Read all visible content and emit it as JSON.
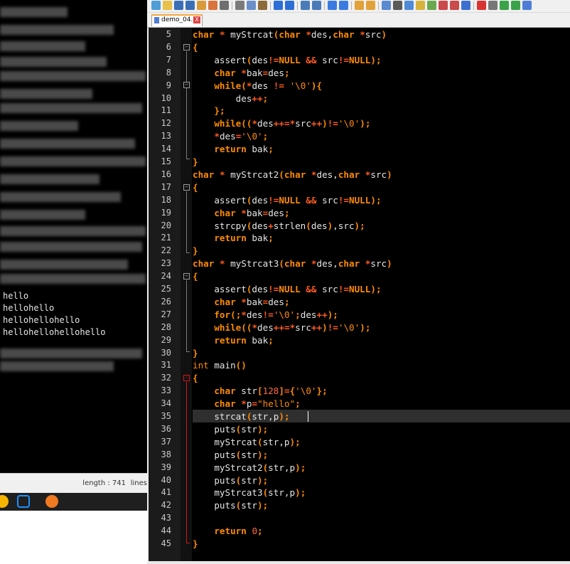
{
  "console": {
    "output_lines": [
      "hello",
      "hellohello",
      "hellohellohello",
      "hellohellohellohello"
    ],
    "status_length": "length : 741",
    "status_lines": "lines"
  },
  "editor": {
    "tab_label": "demo_04.c",
    "tab_close": "X",
    "line_numbers": [
      "5",
      "6",
      "7",
      "8",
      "9",
      "10",
      "11",
      "12",
      "13",
      "14",
      "15",
      "16",
      "17",
      "18",
      "19",
      "20",
      "21",
      "22",
      "23",
      "24",
      "25",
      "26",
      "27",
      "28",
      "29",
      "30",
      "31",
      "32",
      "33",
      "34",
      "35",
      "36",
      "37",
      "38",
      "39",
      "40",
      "41",
      "42",
      "43",
      "44",
      "45"
    ],
    "code_lines": [
      "char * myStrcat(char *des,char *src)",
      "{",
      "    assert(des!=NULL && src!=NULL);",
      "    char *bak=des;",
      "    while(*des != '\\0'){",
      "        des++;",
      "    };",
      "    while((*des++=*src++)!='\\0');",
      "    *des='\\0';",
      "    return bak;",
      "}",
      "char * myStrcat2(char *des,char *src)",
      "{",
      "    assert(des!=NULL && src!=NULL);",
      "    char *bak=des;",
      "    strcpy(des+strlen(des),src);",
      "    return bak;",
      "}",
      "char * myStrcat3(char *des,char *src)",
      "{",
      "    assert(des!=NULL && src!=NULL);",
      "    char *bak=des;",
      "    for(;*des!='\\0';des++);",
      "    while((*des++=*src++)!='\\0');",
      "    return bak;",
      "}",
      "int main()",
      "{",
      "    char str[128]={'\\0'};",
      "    char *p=\"hello\";",
      "    strcat(str,p);",
      "    puts(str);",
      "    myStrcat(str,p);",
      "    puts(str);",
      "    myStrcat2(str,p);",
      "    puts(str);",
      "    myStrcat3(str,p);",
      "    puts(str);",
      "",
      "    return 0;",
      "}"
    ],
    "current_line": "35"
  },
  "colors": {
    "keyword": "#ff8c00",
    "operator": "#ff5a1e",
    "code_text": "#e6e6e6",
    "background": "#000000",
    "fold_marker": "#d31818"
  }
}
